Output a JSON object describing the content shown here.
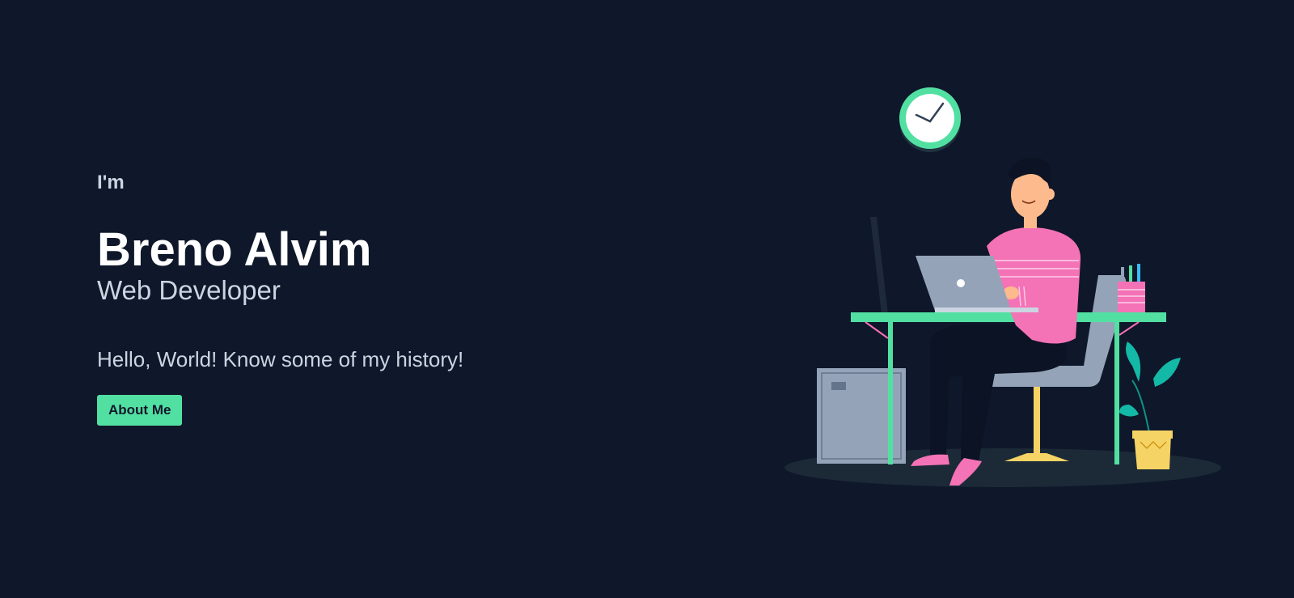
{
  "hero": {
    "intro": "I'm",
    "name": "Breno Alvim",
    "role": "Web Developer",
    "tagline": "Hello, World! Know some of my history!",
    "cta_label": "About Me"
  },
  "colors": {
    "background": "#0f172a",
    "accent": "#52e0a2",
    "text_primary": "#ffffff",
    "text_secondary": "#cbd5e1",
    "shirt": "#f472b6",
    "laptop": "#94a3b8",
    "chair_leg": "#f6d365"
  },
  "illustration": {
    "icons": [
      "wall-clock-icon",
      "developer-at-desk-illustration",
      "plant-icon",
      "pencil-cup-icon",
      "computer-tower-icon"
    ]
  }
}
